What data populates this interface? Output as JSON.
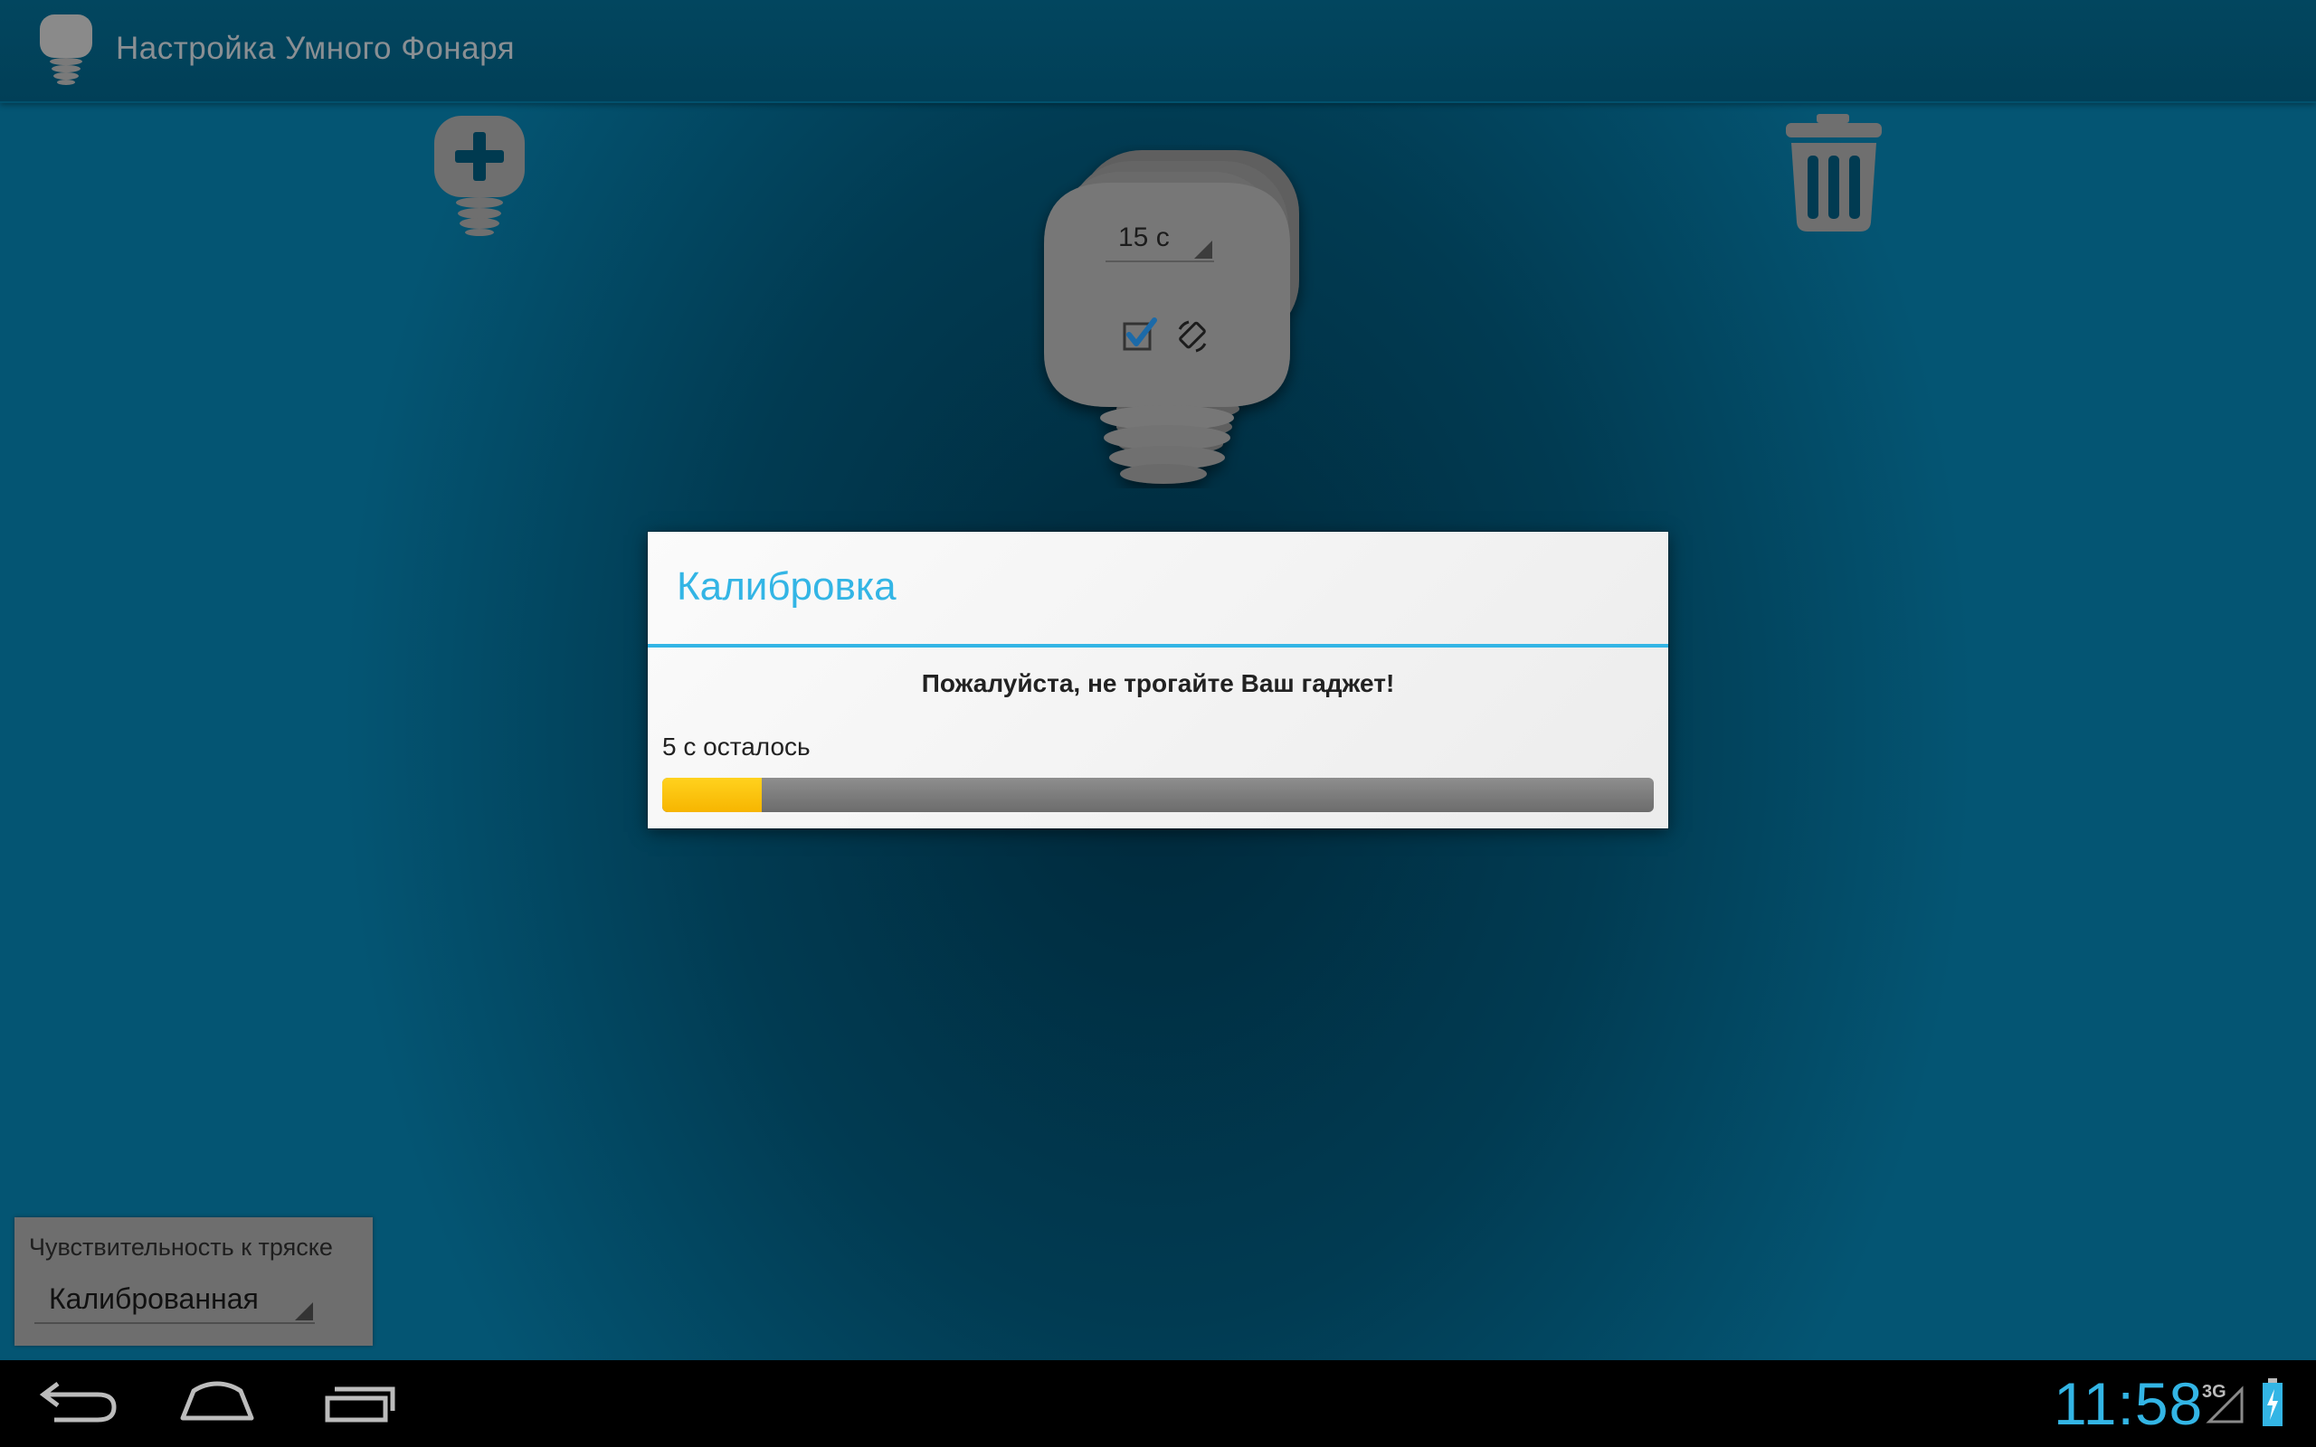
{
  "app": {
    "title": "Настройка Умного Фонаря",
    "icon": "lamp-icon"
  },
  "toolbar": {
    "add_icon": "add-lamp-icon",
    "delete_icon": "trash-icon"
  },
  "lamp": {
    "timer_value": "15 с",
    "checkbox_checked": true,
    "rotate_icon": "rotate-icon"
  },
  "dialog": {
    "title": "Калибровка",
    "message": "Пожалуйста, не трогайте Ваш гаджет!",
    "remaining": "5 с осталось",
    "progress": 0.1
  },
  "sensitivity": {
    "label": "Чувствительность к тряске",
    "value": "Калиброванная"
  },
  "system_bar": {
    "clock": "11:58",
    "network": "3G",
    "buttons": [
      "back",
      "home",
      "recents"
    ]
  },
  "colors": {
    "accent": "#33b5e5",
    "progress": "#ffc400",
    "background": "#013b52"
  }
}
